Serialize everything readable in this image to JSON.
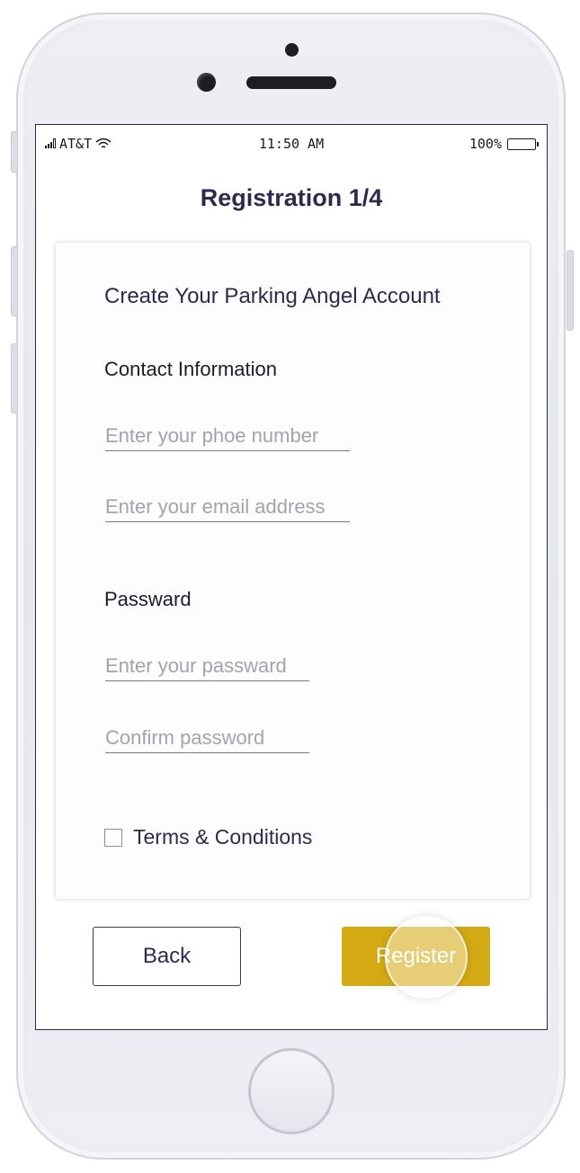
{
  "status_bar": {
    "carrier": "AT&T",
    "time": "11:50 AM",
    "battery": "100%"
  },
  "header": {
    "title": "Registration 1/4"
  },
  "form": {
    "heading": "Create Your Parking Angel Account",
    "contact_label": "Contact Information",
    "phone_placeholder": "Enter your phoe number",
    "email_placeholder": "Enter your email address",
    "password_label": "Passward",
    "password_placeholder": "Enter your passward",
    "confirm_placeholder": "Confirm password",
    "terms_label": "Terms & Conditions",
    "terms_checked": false
  },
  "actions": {
    "back_label": "Back",
    "register_label": "Register"
  },
  "colors": {
    "accent": "#d4aa14",
    "title": "#2e2a4e"
  },
  "icons": {
    "signal": "signal-bars-icon",
    "wifi": "wifi-icon",
    "battery": "battery-icon",
    "checkbox": "checkbox-icon"
  }
}
